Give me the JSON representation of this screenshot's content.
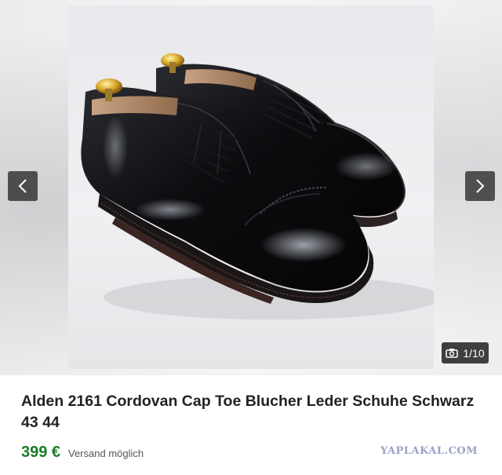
{
  "gallery": {
    "image_alt": "Schwarze Cordovan Cap Toe Blucher Schuhe",
    "prev_icon": "chevron-left-icon",
    "next_icon": "chevron-right-icon",
    "counter_icon": "camera-icon",
    "counter_text": "1/10"
  },
  "listing": {
    "title": "Alden 2161 Cordovan Cap Toe Blucher Leder Schuhe Schwarz 43 44",
    "price": "399 €",
    "shipping": "Versand möglich"
  },
  "watermark": "YAPLAKAL.COM",
  "colors": {
    "price": "#1a7a26",
    "nav_button_bg": "#2a2a2a",
    "watermark": "#9aa3c4"
  }
}
